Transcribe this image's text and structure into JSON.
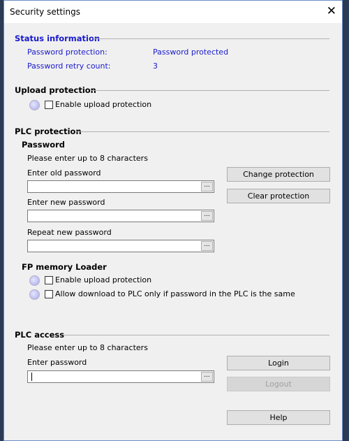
{
  "title": "Security settings",
  "status": {
    "header": "Status information",
    "protection_label": "Password protection:",
    "protection_value": "Password protected",
    "retry_label": "Password retry count:",
    "retry_value": "3"
  },
  "upload": {
    "header": "Upload protection",
    "enable_label": "Enable upload protection",
    "enabled": false
  },
  "plc": {
    "header": "PLC protection",
    "password_header": "Password",
    "hint": "Please enter up to 8 characters",
    "old_label": "Enter old password",
    "new_label": "Enter new password",
    "repeat_label": "Repeat new password",
    "old_value": "",
    "new_value": "",
    "repeat_value": "",
    "browse": "...",
    "change_button": "Change protection",
    "clear_button": "Clear protection"
  },
  "fp": {
    "header": "FP memory Loader",
    "enable_label": "Enable upload protection",
    "allow_label": "Allow download to PLC only if password in the PLC is the same",
    "enable_checked": false,
    "allow_checked": false
  },
  "access": {
    "header": "PLC access",
    "hint": "Please enter up to 8 characters",
    "password_label": "Enter password",
    "password_value": "",
    "browse": "...",
    "login_button": "Login",
    "logout_button": "Logout",
    "help_button": "Help"
  },
  "colors": {
    "status_text": "#1a1acc",
    "led": "#a8a8e8"
  }
}
